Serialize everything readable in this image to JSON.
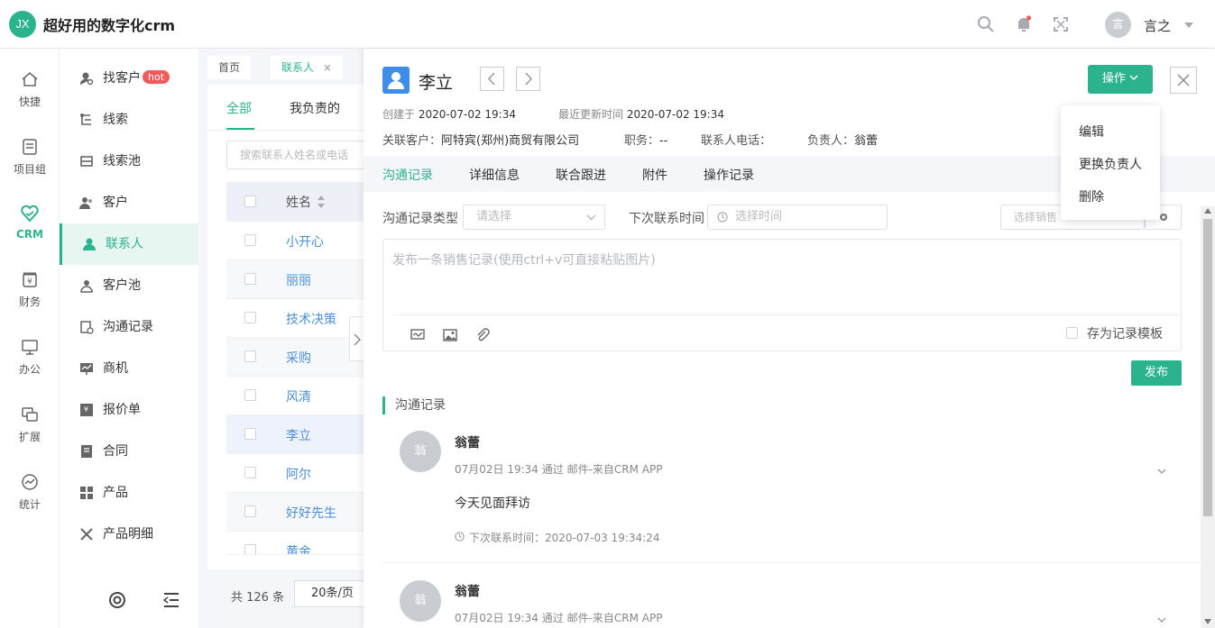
{
  "app": {
    "logo": "JX",
    "title": "超好用的数字化crm"
  },
  "user": {
    "avatar": "言",
    "name": "言之"
  },
  "nav_main": [
    {
      "label": "快捷"
    },
    {
      "label": "项目组"
    },
    {
      "label": "CRM"
    },
    {
      "label": "财务"
    },
    {
      "label": "办公"
    },
    {
      "label": "扩展"
    },
    {
      "label": "统计"
    }
  ],
  "nav_sub": [
    {
      "label": "找客户",
      "badge": "hot"
    },
    {
      "label": "线索"
    },
    {
      "label": "线索池"
    },
    {
      "label": "客户"
    },
    {
      "label": "联系人"
    },
    {
      "label": "客户池"
    },
    {
      "label": "沟通记录"
    },
    {
      "label": "商机"
    },
    {
      "label": "报价单"
    },
    {
      "label": "合同"
    },
    {
      "label": "产品"
    },
    {
      "label": "产品明细"
    }
  ],
  "page_tabs": [
    {
      "label": "首页"
    },
    {
      "label": "联系人",
      "close": "×"
    }
  ],
  "list": {
    "tabs": [
      "全部",
      "我负责的"
    ],
    "search_placeholder": "搜索联系人姓名或电话",
    "column_name": "姓名",
    "rows": [
      "小开心",
      "丽丽",
      "技术决策",
      "采购",
      "风清",
      "李立",
      "阿尔",
      "好好先生",
      "黄金"
    ],
    "total": "共 126 条",
    "page_size": "20条/页"
  },
  "detail": {
    "avatar_icon": "contact-icon",
    "name": "李立",
    "op_button": "操作",
    "created_label": "创建于",
    "created_value": "2020-07-02 19:34",
    "updated_label": "最近更新时间",
    "updated_value": "2020-07-02 19:34",
    "customer_label": "关联客户：",
    "customer_value": "阿特宾(郑州)商贸有限公司",
    "position_label": "职务：",
    "position_value": "--",
    "phone_label": "联系人电话：",
    "phone_value": "",
    "owner_label": "负责人：",
    "owner_value": "翁蕾",
    "tabs": [
      "沟通记录",
      "详细信息",
      "联合跟进",
      "附件",
      "操作记录"
    ],
    "record_type_label": "沟通记录类型",
    "record_type_placeholder": "请选择",
    "next_contact_label": "下次联系时间",
    "next_contact_placeholder": "选择时间",
    "sales_placeholder": "选择销售",
    "textarea_placeholder": "发布一条销售记录(使用ctrl+v可直接粘贴图片)",
    "save_template": "存为记录模板",
    "publish": "发布",
    "section_title": "沟通记录",
    "records": [
      {
        "avatar": "翁",
        "author": "翁蕾",
        "meta": "07月02日 19:34 通过 邮件-来自CRM APP",
        "content": "今天见面拜访",
        "next": "下次联系时间：2020-07-03 19:34:24"
      },
      {
        "avatar": "翁",
        "author": "翁蕾",
        "meta": "07月02日 19:34 通过 邮件-来自CRM APP"
      }
    ]
  },
  "dropdown": [
    "编辑",
    "更换负责人",
    "删除"
  ],
  "colors": {
    "accent": "#2bb38e",
    "link": "#4a8fd6",
    "hot": "#ef5b5b"
  }
}
